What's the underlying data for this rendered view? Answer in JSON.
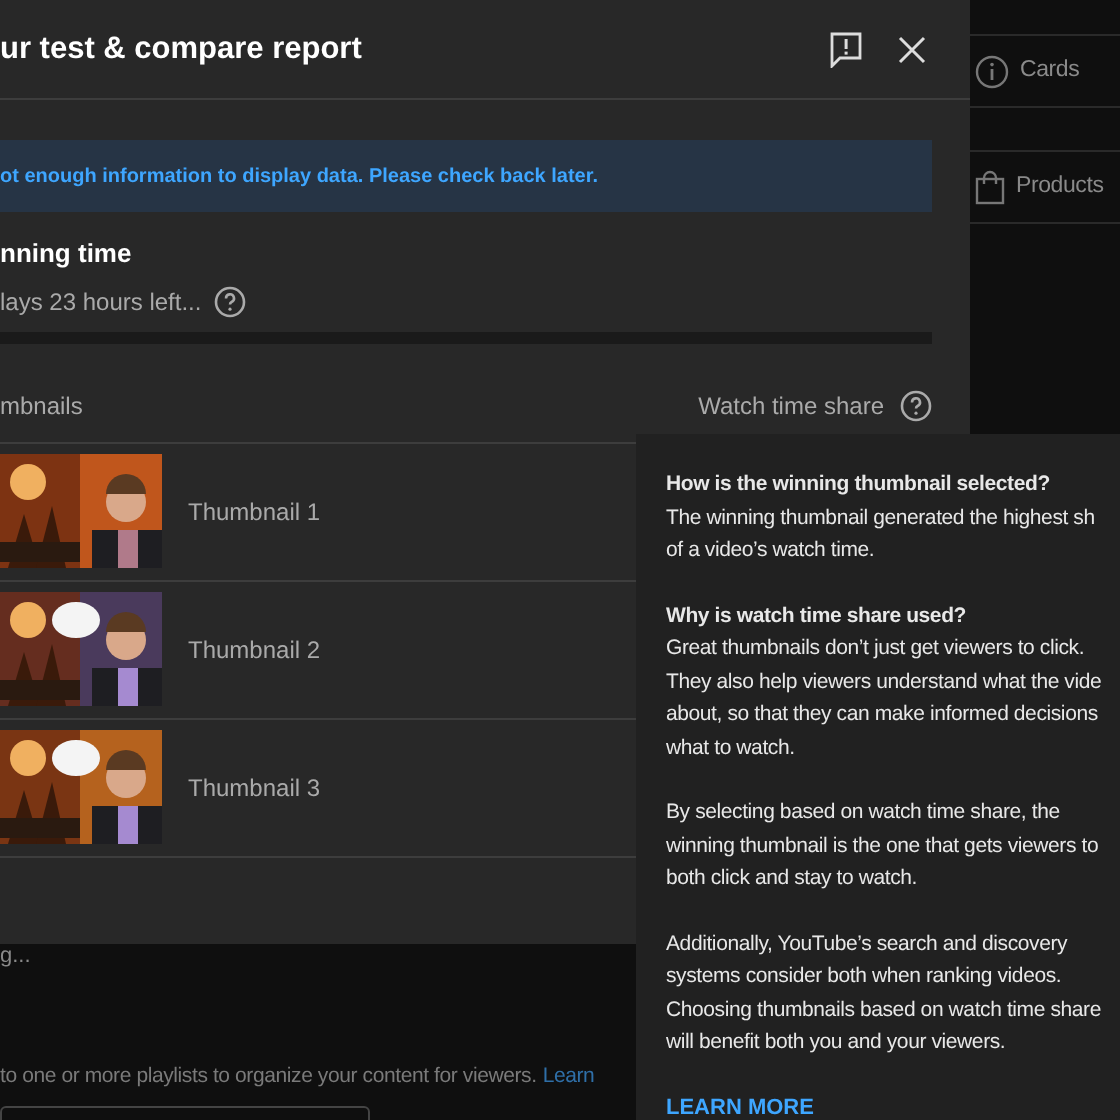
{
  "side_panel": {
    "items": [
      {
        "label": "Cards",
        "kind": "info"
      },
      {
        "label": "Products",
        "kind": "bag"
      }
    ]
  },
  "background": {
    "status": "g...",
    "hint": "to one or more playlists to organize your content for viewers.",
    "link": "Learn"
  },
  "dialog": {
    "title": "ur test & compare report",
    "notice": "ot enough information to display data. Please check back later.",
    "running_time": {
      "label": "nning time",
      "remaining": "lays 23 hours left..."
    },
    "table": {
      "columns": [
        "mbnails",
        "Watch time share"
      ],
      "rows": [
        {
          "label": "Thumbnail 1",
          "kind": "picture"
        },
        {
          "label": "Thumbnail 2",
          "kind": "picture"
        },
        {
          "label": "Thumbnail 3",
          "kind": "picture"
        }
      ]
    }
  },
  "tooltip": {
    "sections": [
      {
        "heading": "How is the winning thumbnail selected?",
        "lines": [
          "The winning thumbnail generated the highest sh",
          "of a video’s watch time."
        ]
      },
      {
        "heading": "Why is watch time share used?",
        "lines": [
          "Great thumbnails don’t just get viewers to click.",
          "They also help viewers understand what the vide",
          "about, so that they can make informed decisions",
          "what to watch."
        ]
      },
      {
        "lines": [
          "By selecting based on watch time share, the",
          "winning thumbnail is the one that gets viewers to",
          "both click and stay to watch."
        ]
      },
      {
        "lines": [
          "Additionally, YouTube’s search and discovery",
          "systems consider both when ranking videos.",
          "Choosing thumbnails based on watch time share",
          "will benefit both you and your viewers."
        ]
      }
    ],
    "link": "LEARN MORE"
  }
}
